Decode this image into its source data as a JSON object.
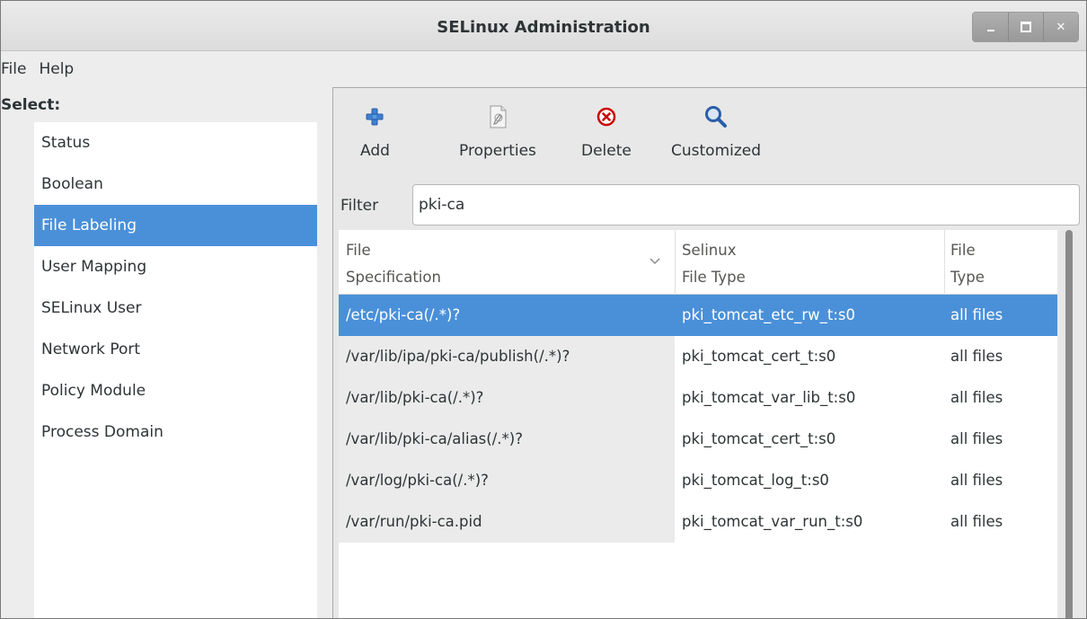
{
  "window": {
    "title": "SELinux Administration"
  },
  "menubar": {
    "items": [
      "File",
      "Help"
    ]
  },
  "sidebar": {
    "select_label": "Select:",
    "items": [
      {
        "label": "Status",
        "selected": false
      },
      {
        "label": "Boolean",
        "selected": false
      },
      {
        "label": "File Labeling",
        "selected": true
      },
      {
        "label": "User Mapping",
        "selected": false
      },
      {
        "label": "SELinux User",
        "selected": false
      },
      {
        "label": "Network Port",
        "selected": false
      },
      {
        "label": "Policy Module",
        "selected": false
      },
      {
        "label": "Process Domain",
        "selected": false
      }
    ]
  },
  "toolbar": {
    "add_label": "Add",
    "properties_label": "Properties",
    "delete_label": "Delete",
    "customized_label": "Customized"
  },
  "filter": {
    "label": "Filter",
    "value": "pki-ca"
  },
  "table": {
    "columns": [
      {
        "line1": "File",
        "line2": "Specification"
      },
      {
        "line1": "Selinux",
        "line2": "File Type"
      },
      {
        "line1": "File",
        "line2": "Type"
      }
    ],
    "rows": [
      {
        "spec": "/etc/pki-ca(/.*)?",
        "selinux_type": "pki_tomcat_etc_rw_t:s0",
        "file_type": "all files",
        "selected": true
      },
      {
        "spec": "/var/lib/ipa/pki-ca/publish(/.*)?",
        "selinux_type": "pki_tomcat_cert_t:s0",
        "file_type": "all files",
        "selected": false
      },
      {
        "spec": "/var/lib/pki-ca(/.*)?",
        "selinux_type": "pki_tomcat_var_lib_t:s0",
        "file_type": "all files",
        "selected": false
      },
      {
        "spec": "/var/lib/pki-ca/alias(/.*)?",
        "selinux_type": "pki_tomcat_cert_t:s0",
        "file_type": "all files",
        "selected": false
      },
      {
        "spec": "/var/log/pki-ca(/.*)?",
        "selinux_type": "pki_tomcat_log_t:s0",
        "file_type": "all files",
        "selected": false
      },
      {
        "spec": "/var/run/pki-ca.pid",
        "selinux_type": "pki_tomcat_var_run_t:s0",
        "file_type": "all files",
        "selected": false
      }
    ]
  },
  "colors": {
    "selection": "#4a90d9",
    "add_icon": "#3f7fd0",
    "delete_icon": "#cc0000",
    "search_icon": "#2a5fa8"
  },
  "icons": {
    "add": "plus-icon",
    "properties": "properties-icon",
    "delete": "delete-icon",
    "customized": "search-icon"
  }
}
